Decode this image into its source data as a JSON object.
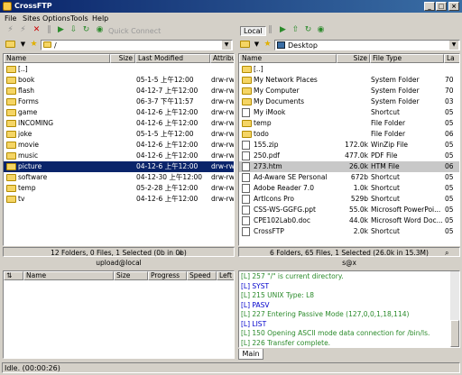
{
  "window": {
    "title": "CrossFTP"
  },
  "menu": [
    "File",
    "Sites",
    "Options",
    "Tools",
    "Help"
  ],
  "toolbar": {
    "quick_connect": "Quick Connect"
  },
  "left": {
    "path": "/",
    "columns": [
      "Name",
      "Size",
      "Last Modified",
      "Attribut"
    ],
    "rows": [
      {
        "name": "[..]",
        "size": "",
        "date": "",
        "attr": ""
      },
      {
        "name": "book",
        "size": "",
        "date": "05-1-5 上午12:00",
        "attr": "drw-rw-"
      },
      {
        "name": "flash",
        "size": "",
        "date": "04-12-7 上午12:00",
        "attr": "drw-rw-"
      },
      {
        "name": "Forms",
        "size": "",
        "date": "06-3-7 下午11:57",
        "attr": "drw-rw-"
      },
      {
        "name": "game",
        "size": "",
        "date": "04-12-6 上午12:00",
        "attr": "drw-rw-"
      },
      {
        "name": "INCOMING",
        "size": "",
        "date": "04-12-6 上午12:00",
        "attr": "drw-rw-"
      },
      {
        "name": "joke",
        "size": "",
        "date": "05-1-5 上午12:00",
        "attr": "drw-rw-"
      },
      {
        "name": "movie",
        "size": "",
        "date": "04-12-6 上午12:00",
        "attr": "drw-rw-"
      },
      {
        "name": "music",
        "size": "",
        "date": "04-12-6 上午12:00",
        "attr": "drw-rw-"
      },
      {
        "name": "picture",
        "size": "",
        "date": "04-12-6 上午12:00",
        "attr": "drw-rw-"
      },
      {
        "name": "software",
        "size": "",
        "date": "04-12-30 上午12:00",
        "attr": "drw-rw-"
      },
      {
        "name": "temp",
        "size": "",
        "date": "05-2-28 上午12:00",
        "attr": "drw-rw-"
      },
      {
        "name": "tv",
        "size": "",
        "date": "04-12-6 上午12:00",
        "attr": "drw-rw-"
      }
    ],
    "status": "12 Folders, 0 Files, 1 Selected (0b in 0b)",
    "conn": "upload@local"
  },
  "right": {
    "tab": "Local",
    "path": "Desktop",
    "columns": [
      "Name",
      "Size",
      "File Type",
      "La"
    ],
    "rows": [
      {
        "name": "[..]",
        "size": "",
        "type": "",
        "last": ""
      },
      {
        "name": "My Network Places",
        "size": "",
        "type": "System Folder",
        "last": "70"
      },
      {
        "name": "My Computer",
        "size": "",
        "type": "System Folder",
        "last": "70"
      },
      {
        "name": "My Documents",
        "size": "",
        "type": "System Folder",
        "last": "03"
      },
      {
        "name": "My iMook",
        "size": "",
        "type": "Shortcut",
        "last": "05"
      },
      {
        "name": "temp",
        "size": "",
        "type": "File Folder",
        "last": "05"
      },
      {
        "name": "todo",
        "size": "",
        "type": "File Folder",
        "last": "06"
      },
      {
        "name": "155.zip",
        "size": "172.0k",
        "type": "WinZip File",
        "last": "05"
      },
      {
        "name": "250.pdf",
        "size": "477.0k",
        "type": "PDF File",
        "last": "05"
      },
      {
        "name": "273.htm",
        "size": "26.0k",
        "type": "HTM File",
        "last": "06"
      },
      {
        "name": "Ad-Aware SE Personal",
        "size": "672b",
        "type": "Shortcut",
        "last": "05"
      },
      {
        "name": "Adobe Reader 7.0",
        "size": "1.0k",
        "type": "Shortcut",
        "last": "05"
      },
      {
        "name": "ArtIcons Pro",
        "size": "529b",
        "type": "Shortcut",
        "last": "05"
      },
      {
        "name": "CSS-WS-GGFG.ppt",
        "size": "55.0k",
        "type": "Microsoft PowerPoi...",
        "last": "05"
      },
      {
        "name": "CPE102Lab0.doc",
        "size": "44.0k",
        "type": "Microsoft Word Doc...",
        "last": "05"
      },
      {
        "name": "CrossFTP",
        "size": "2.0k",
        "type": "Shortcut",
        "last": "05"
      }
    ],
    "status": "6 Folders, 65 Files, 1 Selected (26.0k in 15.3M)",
    "conn": "s@x"
  },
  "queue": {
    "columns": [
      "Name",
      "Size",
      "Progress",
      "Speed",
      "Left"
    ]
  },
  "log": {
    "lines": [
      {
        "text": "[L] 257 \"/\" is current directory.",
        "color": "#2a8a2a"
      },
      {
        "text": "[L] SYST",
        "color": "#0000cc"
      },
      {
        "text": "[L] 215 UNIX Type: L8",
        "color": "#2a8a2a"
      },
      {
        "text": "[L] PASV",
        "color": "#0000cc"
      },
      {
        "text": "[L] 227 Entering Passive Mode (127,0,0,1,18,114)",
        "color": "#2a8a2a"
      },
      {
        "text": "[L] LIST",
        "color": "#0000cc"
      },
      {
        "text": "[L] 150 Opening ASCII mode data connection for /bin/ls.",
        "color": "#2a8a2a"
      },
      {
        "text": "[L] 226 Transfer complete.",
        "color": "#2a8a2a"
      }
    ],
    "tab": "Main"
  },
  "statusbar": {
    "text": "Idle. (00:00:26)"
  },
  "colors": {
    "selection": "#0a246a",
    "titlebar": "#0a246a",
    "folder": "#f5d565"
  }
}
